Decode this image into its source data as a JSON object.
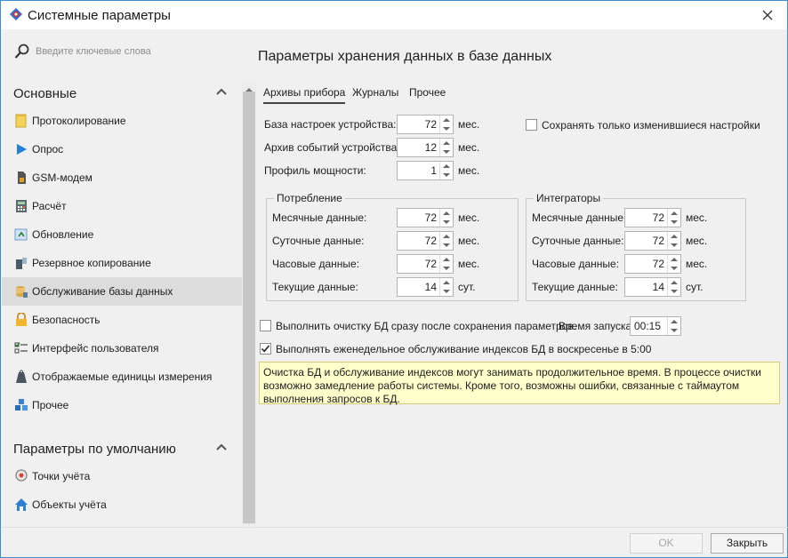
{
  "window": {
    "title": "Системные параметры"
  },
  "sidebar": {
    "search_placeholder": "Введите ключевые слова",
    "groups": [
      {
        "title": "Основные",
        "items": [
          {
            "label": "Протоколирование",
            "icon": "notepad-icon"
          },
          {
            "label": "Опрос",
            "icon": "play-icon"
          },
          {
            "label": "GSM-модем",
            "icon": "sim-card-icon"
          },
          {
            "label": "Расчёт",
            "icon": "calculator-icon"
          },
          {
            "label": "Обновление",
            "icon": "update-icon"
          },
          {
            "label": "Резервное копирование",
            "icon": "backup-icon"
          },
          {
            "label": "Обслуживание базы данных",
            "icon": "database-icon",
            "active": true
          },
          {
            "label": "Безопасность",
            "icon": "lock-icon"
          },
          {
            "label": "Интерфейс пользователя",
            "icon": "checklist-icon"
          },
          {
            "label": "Отображаемые единицы измерения",
            "icon": "weight-icon"
          },
          {
            "label": "Прочее",
            "icon": "cubes-icon"
          }
        ]
      },
      {
        "title": "Параметры по умолчанию",
        "items": [
          {
            "label": "Точки учёта",
            "icon": "meter-point-icon"
          },
          {
            "label": "Объекты учёта",
            "icon": "house-icon"
          }
        ]
      }
    ]
  },
  "main": {
    "title": "Параметры хранения данных в базе данных",
    "tabs": [
      {
        "label": "Архивы прибора",
        "active": true
      },
      {
        "label": "Журналы"
      },
      {
        "label": "Прочее"
      }
    ],
    "device": {
      "settings_label": "База настроек устройства:",
      "settings_value": "72",
      "settings_unit": "мес.",
      "events_label": "Архив событий устройства:",
      "events_value": "12",
      "events_unit": "мес.",
      "power_label": "Профиль мощности:",
      "power_value": "1",
      "power_unit": "мес."
    },
    "save_changed_only": {
      "label": "Сохранять только изменившиеся настройки",
      "checked": false
    },
    "consumption": {
      "title": "Потребление",
      "rows": [
        {
          "label": "Месячные данные:",
          "value": "72",
          "unit": "мес."
        },
        {
          "label": "Суточные данные:",
          "value": "72",
          "unit": "мес."
        },
        {
          "label": "Часовые данные:",
          "value": "72",
          "unit": "мес."
        },
        {
          "label": "Текущие данные:",
          "value": "14",
          "unit": "сут."
        }
      ]
    },
    "integrators": {
      "title": "Интеграторы",
      "rows": [
        {
          "label": "Месячные данные:",
          "value": "72",
          "unit": "мес."
        },
        {
          "label": "Суточные данные:",
          "value": "72",
          "unit": "мес."
        },
        {
          "label": "Часовые данные:",
          "value": "72",
          "unit": "мес."
        },
        {
          "label": "Текущие данные:",
          "value": "14",
          "unit": "сут."
        }
      ]
    },
    "cleanup": {
      "label": "Выполнить очистку БД сразу после сохранения параметров.",
      "checked": false,
      "start_time_label": "Время запуска:",
      "start_time_value": "00:15"
    },
    "weekly": {
      "label": "Выполнять еженедельное обслуживание индексов БД в воскресенье в 5:00",
      "checked": true
    },
    "warning": "Очистка БД и обслуживание индексов могут занимать продолжительное время. В процессе очистки возможно замедление работы системы. Кроме того, возможны ошибки, связанные с таймаутом выполнения запросов к БД."
  },
  "footer": {
    "ok_label": "OK",
    "close_label": "Закрыть"
  },
  "colors": {
    "window_border": "#3c8ed8",
    "active_item": "#dcdcdc",
    "warning_bg": "#ffffcc"
  }
}
